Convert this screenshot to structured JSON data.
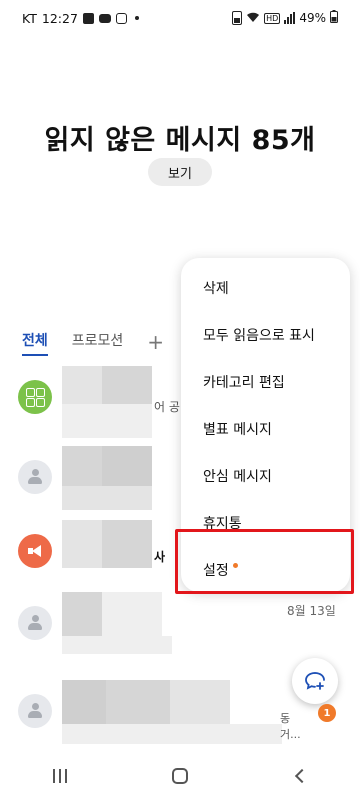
{
  "status_bar": {
    "carrier": "KT",
    "time": "12:27",
    "battery": "49%"
  },
  "header": {
    "title": "읽지 않은 메시지 85개",
    "view_button": "보기"
  },
  "tabs": [
    {
      "label": "전체",
      "active": true
    },
    {
      "label": "프로모션",
      "active": false
    }
  ],
  "tab_add": "+",
  "conversation_peek": {
    "row1_snippet": "어 공",
    "row3_snippet": "사",
    "row5_snippet1": "동",
    "row5_snippet2": "거..."
  },
  "list_date": "8월 13일",
  "menu": {
    "items": [
      {
        "label": "삭제"
      },
      {
        "label": "모두 읽음으로 표시"
      },
      {
        "label": "카테고리 편집"
      },
      {
        "label": "별표 메시지"
      },
      {
        "label": "안심 메시지"
      },
      {
        "label": "휴지통"
      },
      {
        "label": "설정",
        "has_dot": true
      }
    ]
  },
  "fab": {
    "badge_count": "1"
  },
  "colors": {
    "accent": "#1d4fb5",
    "highlight": "#e2161b",
    "badge": "#f07a2a"
  }
}
